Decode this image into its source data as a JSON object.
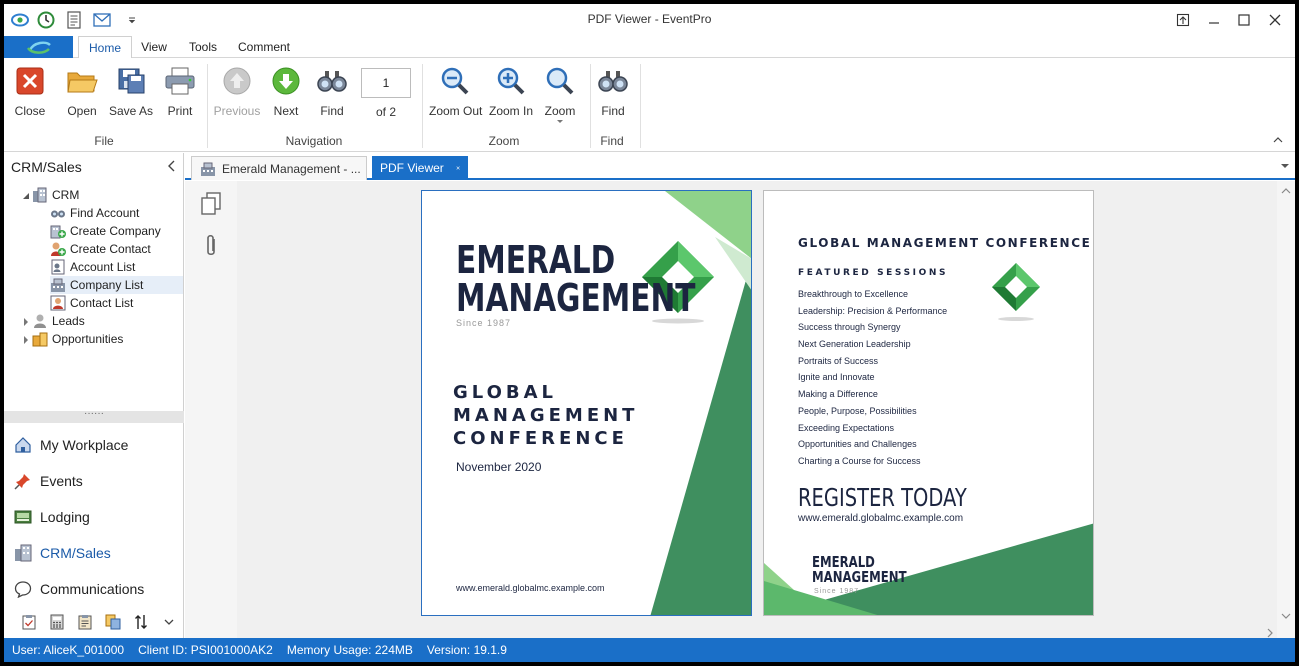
{
  "window": {
    "title": "PDF Viewer - EventPro"
  },
  "ribbon_tabs": [
    "Home",
    "View",
    "Tools",
    "Comment"
  ],
  "ribbon": {
    "close": "Close",
    "open": "Open",
    "save_as": "Save As",
    "print": "Print",
    "previous": "Previous",
    "next": "Next",
    "find": "Find",
    "page_number": "1",
    "page_of": "of 2",
    "zoom_out": "Zoom Out",
    "zoom_in": "Zoom In",
    "zoom": "Zoom",
    "find2": "Find",
    "groups": {
      "file": "File",
      "navigation": "Navigation",
      "zoom": "Zoom",
      "find": "Find"
    }
  },
  "nav": {
    "header": "CRM/Sales",
    "tree": {
      "crm": "CRM",
      "find_account": "Find Account",
      "create_company": "Create Company",
      "create_contact": "Create Contact",
      "account_list": "Account List",
      "company_list": "Company List",
      "contact_list": "Contact List",
      "leads": "Leads",
      "opportunities": "Opportunities"
    },
    "modules": {
      "my_workplace": "My Workplace",
      "events": "Events",
      "lodging": "Lodging",
      "crm_sales": "CRM/Sales",
      "communications": "Communications"
    }
  },
  "doc_tabs": {
    "inactive": "Emerald Management - ...",
    "active": "PDF Viewer"
  },
  "pdf": {
    "page1": {
      "brand_line1": "EMERALD",
      "brand_line2": "MANAGEMENT",
      "since": "Since 1987",
      "conf_line1": "GLOBAL",
      "conf_line2": "MANAGEMENT",
      "conf_line3": "CONFERENCE",
      "date": "November 2020",
      "url": "www.emerald.globalmc.example.com"
    },
    "page2": {
      "title": "GLOBAL MANAGEMENT CONFERENCE",
      "sessions_heading": "FEATURED SESSIONS",
      "sessions": [
        "Breakthrough to Excellence",
        "Leadership: Precision & Performance",
        "Success through Synergy",
        "Next Generation Leadership",
        "Portraits of Success",
        "Ignite and Innovate",
        "Making a Difference",
        "People, Purpose, Possibilities",
        "Exceeding Expectations",
        "Opportunities and Challenges",
        "Charting a Course for Success"
      ],
      "register": "REGISTER TODAY",
      "url": "www.emerald.globalmc.example.com",
      "brand_line1": "EMERALD",
      "brand_line2": "MANAGEMENT",
      "since": "Since 1987"
    }
  },
  "status": {
    "user": "User: AliceK_001000",
    "client": "Client ID: PSI001000AK2",
    "memory": "Memory Usage: 224MB",
    "version": "Version: 19.1.9"
  },
  "colors": {
    "accent": "#1a6fc8",
    "green_dark": "#2e8b57",
    "green_light": "#7ec87e",
    "navy": "#1c2540"
  }
}
